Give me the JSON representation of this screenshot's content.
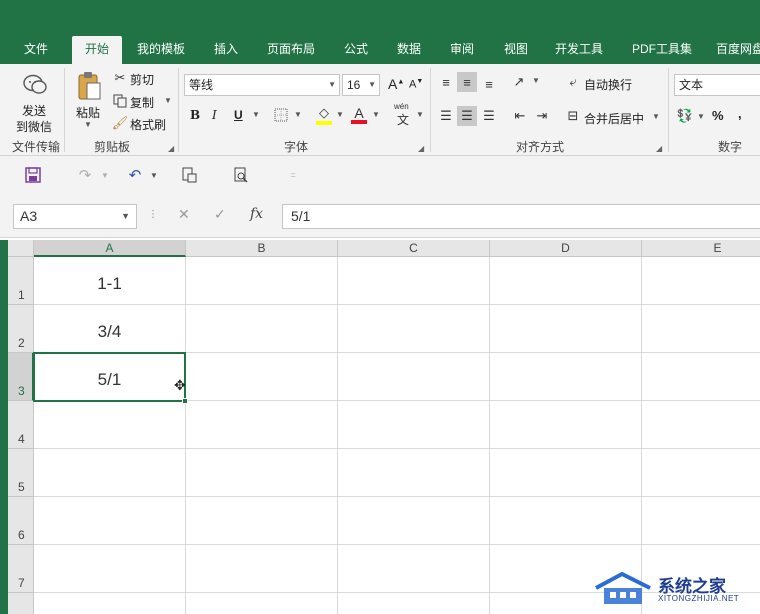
{
  "tabs": [
    "文件",
    "开始",
    "我的模板",
    "插入",
    "页面布局",
    "公式",
    "数据",
    "审阅",
    "视图",
    "开发工具",
    "PDF工具集",
    "百度网盘"
  ],
  "active_tab": "开始",
  "ribbon": {
    "wechat": {
      "label_line1": "发送",
      "label_line2": "到微信",
      "group": "文件传输"
    },
    "clipboard": {
      "paste": "粘贴",
      "cut": "剪切",
      "copy": "复制",
      "format_painter": "格式刷",
      "group": "剪贴板"
    },
    "font": {
      "font_name": "等线",
      "font_size": "16",
      "bold": "B",
      "italic": "I",
      "underline": "U",
      "wen": "wén",
      "wen_char": "文",
      "group": "字体",
      "grow": "A",
      "shrink": "A",
      "font_color_letter": "A"
    },
    "alignment": {
      "wrap_text": "自动换行",
      "merge_center": "合并后居中",
      "group": "对齐方式"
    },
    "number": {
      "format": "文本",
      "percent": "%",
      "comma": ",",
      "group": "数字"
    }
  },
  "formula_bar": {
    "name_box": "A3",
    "fx": "fx",
    "cancel": "✕",
    "enter": "✓",
    "content": "5/1"
  },
  "columns": [
    "A",
    "B",
    "C",
    "D",
    "E"
  ],
  "rows": [
    "1",
    "2",
    "3",
    "4",
    "5",
    "6",
    "7"
  ],
  "cells": {
    "A1": "1-1",
    "A2": "3/4",
    "A3": "5/1"
  },
  "selected_cell": "A3",
  "watermark": {
    "title": "系统之家",
    "subtitle": "XITONGZHIJIA.NET"
  },
  "colors": {
    "accent": "#217346",
    "ribbon_bg": "#f3f3f3",
    "header_bg": "#e6e6e6"
  }
}
